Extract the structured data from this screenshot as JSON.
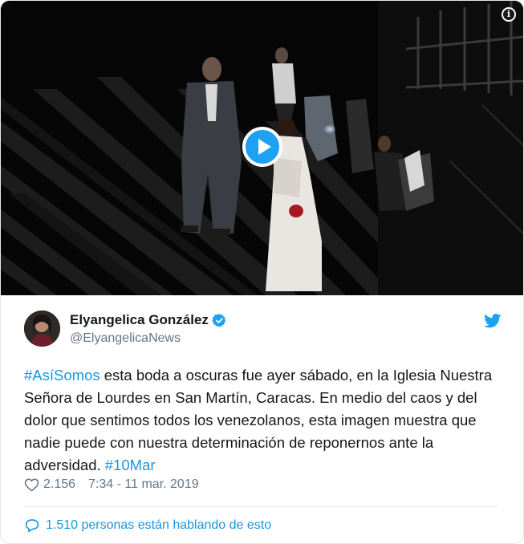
{
  "media": {
    "play_icon": "play-icon",
    "info_icon": "info-icon"
  },
  "author": {
    "display_name": "Elyangelica González",
    "handle": "@ElyangelicaNews",
    "verified_icon": "verified-badge-icon",
    "platform_icon": "twitter-bird-icon"
  },
  "tweet": {
    "hashtag_1": "#AsíSomos",
    "body": " esta boda a oscuras fue ayer sábado, en la Iglesia Nuestra Señora de Lourdes en San Martín, Caracas. En medio del caos y del dolor que sentimos todos los venezolanos, esta imagen muestra que nadie puede con nuestra determinación de reponernos ante la adversidad. ",
    "hashtag_2": "#10Mar"
  },
  "meta": {
    "likes": "2.156",
    "timestamp": "7:34 - 11 mar. 2019"
  },
  "footer": {
    "talking_label": "1.510 personas están hablando de esto"
  },
  "colors": {
    "accent": "#1da1f2",
    "link": "#1b95e0",
    "text": "#14171a",
    "secondary": "#657786"
  }
}
